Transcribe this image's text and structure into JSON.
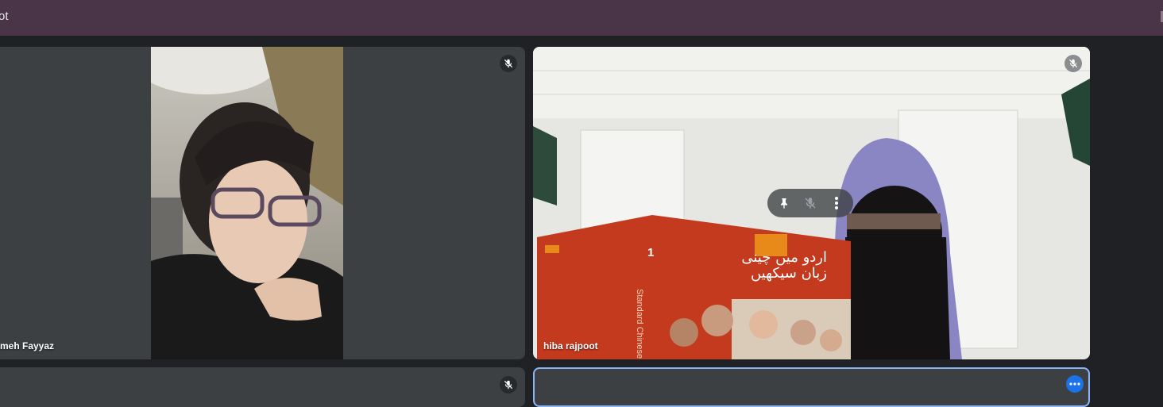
{
  "window": {
    "title": "ot"
  },
  "participants": [
    {
      "name": "meh Fayyaz",
      "muted": true
    },
    {
      "name": "hiba rajpoot",
      "muted": true
    }
  ],
  "book": {
    "spine_number": "1",
    "title_line1": "اردو میں چینی",
    "title_line2": "زبان سیکھیں",
    "spine_text": "Standard Chinese"
  },
  "icons": {
    "mute": "mic-off-icon",
    "pin": "pin-icon",
    "more": "more-vert-icon",
    "options": "more-horiz-icon"
  },
  "colors": {
    "topbar": "#4a3548",
    "background": "#202124",
    "tile": "#3c4043",
    "active_outline": "#8ab4f8",
    "accent": "#1a73e8"
  }
}
